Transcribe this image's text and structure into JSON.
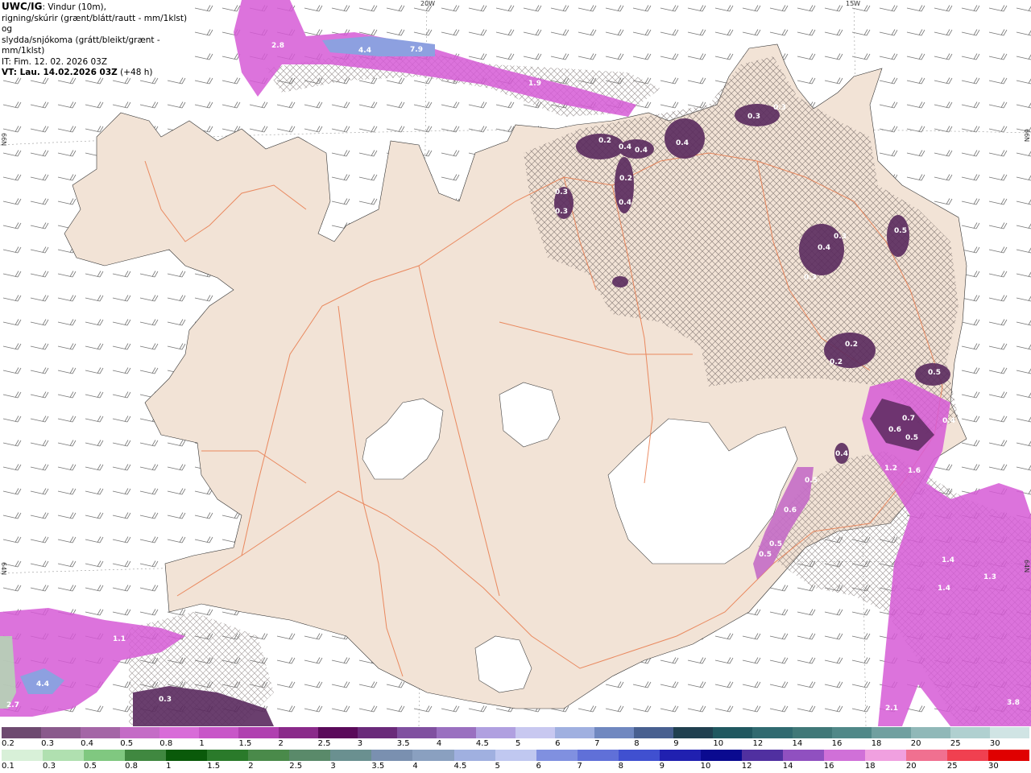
{
  "header": {
    "model": "UWC/IG",
    "line1_rest": ": Vindur (10m),",
    "line2": "rigning/skúrir (grænt/blátt/rautt - mm/1klst) og",
    "line3": "slydda/snjókoma (grátt/bleikt/grænt - mm/1klst)",
    "it": "IT: Fim. 12. 02. 2026 03Z",
    "vt_bold": "VT: Lau. 14.02.2026 03Z",
    "vt_rest": " (+48 h)"
  },
  "grid_labels": {
    "top_a": "20W",
    "top_b": "15W",
    "left_a": "66N",
    "left_b": "64N",
    "right_a": "66N",
    "right_b": "64N"
  },
  "colors": {
    "land": "#f2e3d6",
    "sea": "#ffffff",
    "roads": "#e8794a",
    "precip_purple_dark": "#5a2a5e",
    "precip_magenta": "#d65ad6",
    "precip_blue": "#8da0e0"
  },
  "precip_labels": [
    {
      "v": "2.8"
    },
    {
      "v": "4.4"
    },
    {
      "v": "7.9"
    },
    {
      "v": "1.9"
    },
    {
      "v": "0.2"
    },
    {
      "v": "0.4"
    },
    {
      "v": "0.4"
    },
    {
      "v": "0.4"
    },
    {
      "v": "0.3"
    },
    {
      "v": "0.3"
    },
    {
      "v": "0.2"
    },
    {
      "v": "0.4"
    },
    {
      "v": "0.3"
    },
    {
      "v": "0.3"
    },
    {
      "v": "0.5"
    },
    {
      "v": "0.4"
    },
    {
      "v": "0.3"
    },
    {
      "v": "0.3"
    },
    {
      "v": "0.2"
    },
    {
      "v": "0.2"
    },
    {
      "v": "0.5"
    },
    {
      "v": "0.4"
    },
    {
      "v": "0.7"
    },
    {
      "v": "0.6"
    },
    {
      "v": "0.5"
    },
    {
      "v": "0.4"
    },
    {
      "v": "1.2"
    },
    {
      "v": "1.6"
    },
    {
      "v": "0.5"
    },
    {
      "v": "0.6"
    },
    {
      "v": "0.5"
    },
    {
      "v": "0.5"
    },
    {
      "v": "1.4"
    },
    {
      "v": "1.3"
    },
    {
      "v": "1.4"
    },
    {
      "v": "1.1"
    },
    {
      "v": "4.4"
    },
    {
      "v": "2.7"
    },
    {
      "v": "0.3"
    },
    {
      "v": "2.1"
    },
    {
      "v": "3.8"
    }
  ],
  "legend_snow": {
    "labels": [
      "0.2",
      "0.3",
      "0.4",
      "0.5",
      "0.8",
      "1",
      "1.5",
      "2",
      "2.5",
      "3",
      "3.5",
      "4",
      "4.5",
      "5",
      "6",
      "7",
      "8",
      "9",
      "10",
      "12",
      "14",
      "16",
      "18",
      "20",
      "25",
      "30"
    ],
    "colors": [
      "#6e4a70",
      "#8a5a8c",
      "#a466a6",
      "#c46cc6",
      "#d86cd8",
      "#c856c8",
      "#b040b0",
      "#8a2a8a",
      "#5a0a5a",
      "#6a2a7a",
      "#8050a0",
      "#9a70c0",
      "#b0a0e0",
      "#c8c8f0",
      "#a0b0e0",
      "#7088c0",
      "#486090",
      "#204050",
      "#205860",
      "#306a70",
      "#407878",
      "#508888",
      "#70a0a0",
      "#90b8b8",
      "#b0d0d0",
      "#d0e4e4"
    ]
  },
  "legend_rain": {
    "labels": [
      "0.1",
      "0.3",
      "0.5",
      "0.8",
      "1",
      "1.5",
      "2",
      "2.5",
      "3",
      "3.5",
      "4",
      "4.5",
      "5",
      "6",
      "7",
      "8",
      "9",
      "10",
      "12",
      "14",
      "16",
      "18",
      "20",
      "25",
      "30"
    ],
    "colors": [
      "#d8f0d8",
      "#b0e0b0",
      "#80c880",
      "#408840",
      "#0a5a0a",
      "#2a7a2a",
      "#4a8a4a",
      "#5a8a6a",
      "#6a9090",
      "#7a90b0",
      "#8aa0c0",
      "#a0b0e0",
      "#c0c8f0",
      "#8090e0",
      "#6070d8",
      "#4050d0",
      "#2020b0",
      "#0a0a90",
      "#5030a0",
      "#9050c0",
      "#d070d8",
      "#f0a0e0",
      "#f07090",
      "#f04050",
      "#e00000"
    ]
  }
}
